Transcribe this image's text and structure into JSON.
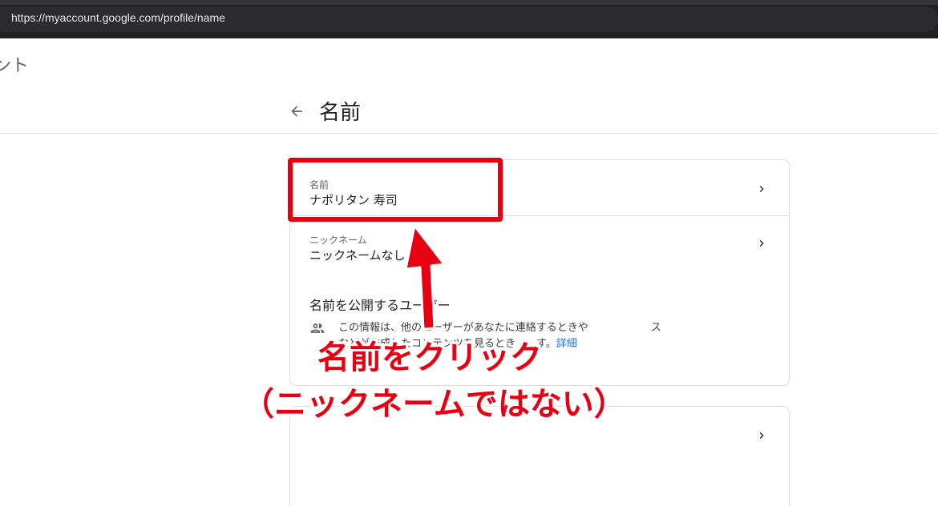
{
  "browser": {
    "url": "https://myaccount.google.com/profile/name"
  },
  "app": {
    "title": "ント"
  },
  "header": {
    "title": "名前"
  },
  "name_row": {
    "label": "名前",
    "value": "ナポリタン 寿司"
  },
  "nickname_row": {
    "label": "ニックネーム",
    "value": "ニックネームなし"
  },
  "visibility": {
    "heading": "名前を公開するユーザー",
    "info_text": "この情報は、他のユーザーがあなたに連絡するときや　　　　　　スなどが作成したコンテンツを見るとき　　す。",
    "learn_more": "詳細"
  },
  "annotation": {
    "line1": "名前をクリック",
    "line2": "（ニックネームではない）"
  },
  "colors": {
    "highlight_red": "#e60012",
    "browser_bg": "#202124",
    "link_blue": "#1a73e8"
  },
  "icons": {
    "back": "arrow-left-icon",
    "chevron": "chevron-right-icon",
    "people": "people-icon"
  }
}
